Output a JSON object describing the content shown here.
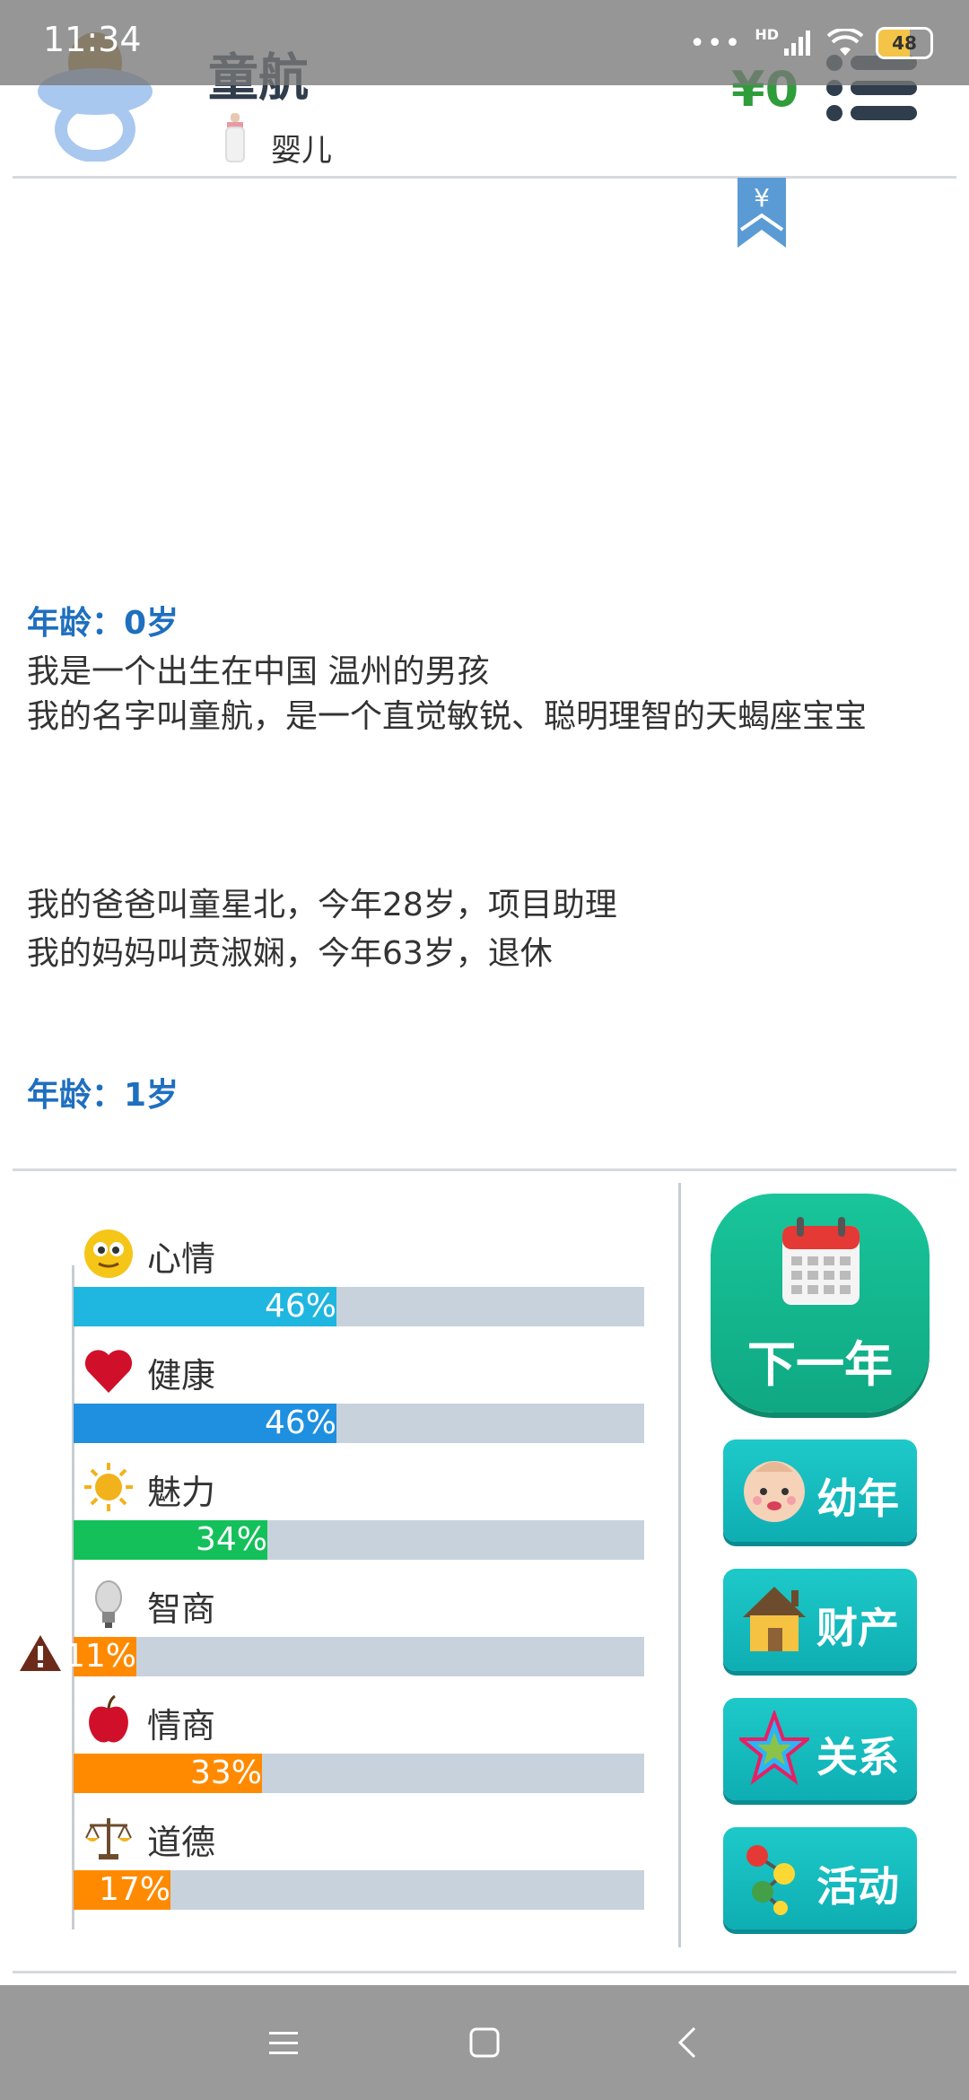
{
  "status_bar": {
    "time": "11:34",
    "network": "HD",
    "battery": "48"
  },
  "header": {
    "name": "童航",
    "stage": "婴儿",
    "money": "¥0",
    "bookmark_symbol": "¥"
  },
  "story": {
    "age0": "年龄：0岁",
    "line1": "我是一个出生在中国 温州的男孩",
    "line2": "我的名字叫童航，是一个直觉敏锐、聪明理智的天蝎座宝宝",
    "line3": "我的爸爸叫童星北，今年28岁，项目助理",
    "line4": "我的妈妈叫贲淑娴，今年63岁，退休",
    "age1": "年龄：1岁"
  },
  "stats": [
    {
      "label": "心情",
      "value": 46,
      "text": "46%",
      "color": "#1fb6e0",
      "icon": "smiley-icon"
    },
    {
      "label": "健康",
      "value": 46,
      "text": "46%",
      "color": "#1f8fe0",
      "icon": "heart-icon"
    },
    {
      "label": "魅力",
      "value": 34,
      "text": "34%",
      "color": "#14c05a",
      "icon": "sun-icon"
    },
    {
      "label": "智商",
      "value": 11,
      "text": "11%",
      "color": "#ff8a00",
      "icon": "lightbulb-icon",
      "warning": true
    },
    {
      "label": "情商",
      "value": 33,
      "text": "33%",
      "color": "#ff8a00",
      "icon": "apple-icon"
    },
    {
      "label": "道德",
      "value": 17,
      "text": "17%",
      "color": "#ff8a00",
      "icon": "scales-icon"
    }
  ],
  "actions": {
    "next_year": "下一年",
    "childhood": "幼年",
    "property": "财产",
    "relations": "关系",
    "activities": "活动"
  },
  "colors": {
    "accent_green": "#19c59a",
    "accent_teal": "#1ec9c9",
    "age_blue": "#1f6fbf",
    "money_green": "#2e9d3a"
  }
}
